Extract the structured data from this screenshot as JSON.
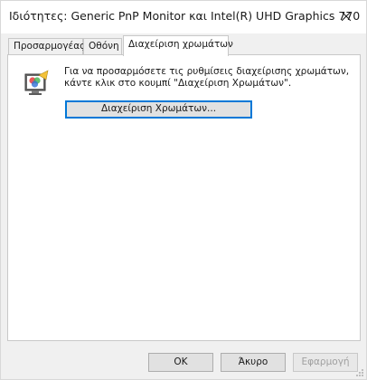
{
  "window": {
    "title": "Ιδιότητες: Generic PnP Monitor και Intel(R) UHD Graphics 770"
  },
  "tabs": [
    {
      "label": "Προσαρμογέας",
      "active": false
    },
    {
      "label": "Οθόνη",
      "active": false
    },
    {
      "label": "Διαχείριση χρωμάτων",
      "active": true
    }
  ],
  "panel": {
    "icon": "color-management-icon",
    "description": "Για να προσαρμόσετε τις ρυθμίσεις διαχείρισης χρωμάτων, κάντε κλικ στο κουμπί \"Διαχείριση Χρωμάτων\".",
    "button_label": "Διαχείριση Χρωμάτων..."
  },
  "footer": {
    "ok_label": "OK",
    "cancel_label": "Άκυρο",
    "apply_label": "Εφαρμογή"
  },
  "colors": {
    "focus_border": "#0078d7",
    "button_bg": "#e1e1e1",
    "dialog_bg": "#f0f0f0"
  }
}
